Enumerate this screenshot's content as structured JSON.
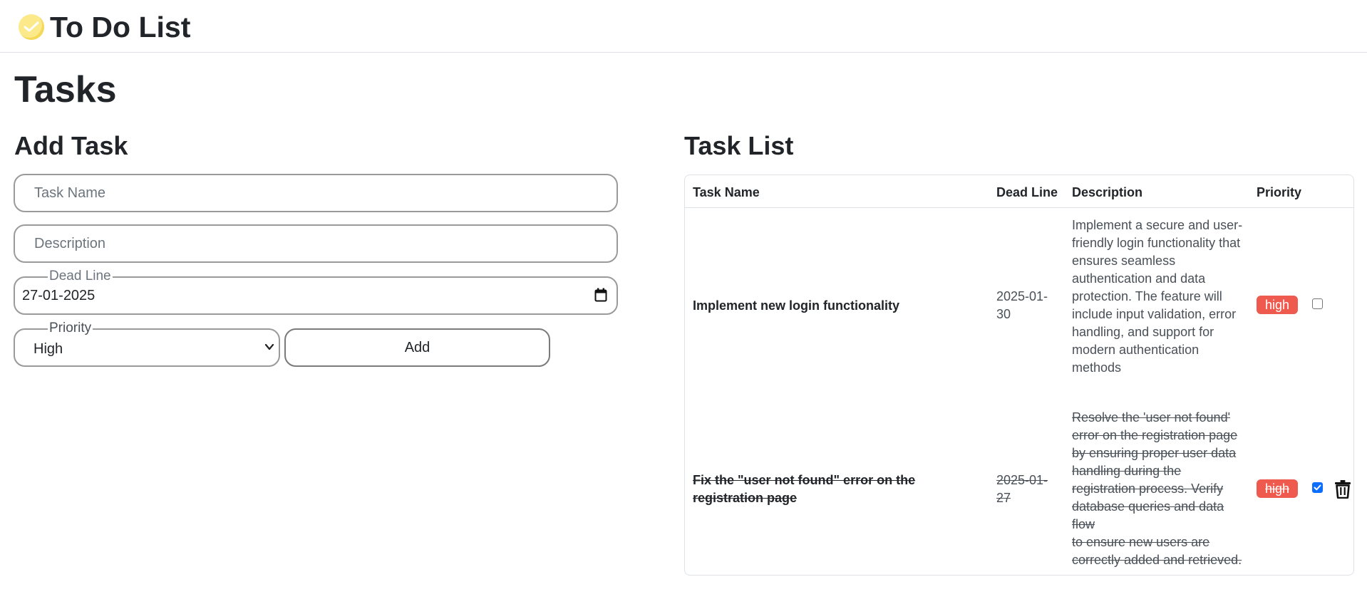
{
  "app": {
    "brand": "To Do List"
  },
  "page": {
    "title": "Tasks"
  },
  "add_task": {
    "title": "Add Task",
    "name_placeholder": "Task Name",
    "description_placeholder": "Description",
    "deadline_label": "Dead Line",
    "deadline_value": "27-01-2025",
    "priority_label": "Priority",
    "priority_value": "High",
    "add_label": "Add"
  },
  "task_list": {
    "title": "Task List",
    "columns": [
      "Task Name",
      "Dead Line",
      "Description",
      "Priority"
    ],
    "rows": [
      {
        "name": "Implement new login functionality",
        "deadline": "2025-01-30",
        "description": "Implement a secure and user-friendly login functionality that ensures seamless authentication and data protection. The feature will include input validation, error handling, and support for\nmodern authentication methods",
        "priority": "high",
        "completed": false
      },
      {
        "name": "Fix the \"user not found\" error on the registration page",
        "deadline": "2025-01-27",
        "description": "Resolve the 'user not found' error on the registration page by ensuring proper user data handling during the registration process. Verify database queries and data flow\nto ensure new users are correctly added and retrieved.",
        "priority": "high",
        "completed": true
      }
    ]
  },
  "colors": {
    "priority_high": "#ef5a4e",
    "checkbox_checked": "#0d6efd",
    "logo": "#fbe98a"
  },
  "icons": {
    "logo": "check-circle-icon",
    "date": "calendar-icon",
    "select": "chevron-down-icon",
    "delete": "trash-icon"
  }
}
